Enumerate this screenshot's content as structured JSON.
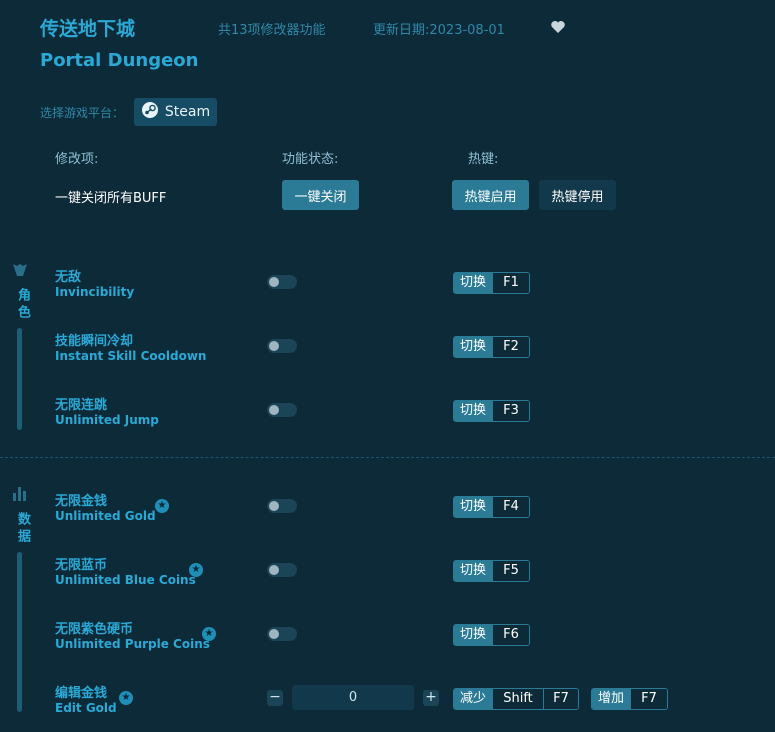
{
  "header": {
    "title_cn": "传送地下城",
    "title_en": "Portal Dungeon",
    "count": "共13项修改器功能",
    "updated": "更新日期:2023-08-01",
    "favorite_icon": "heart-icon"
  },
  "platform": {
    "label": "选择游戏平台：",
    "steam": "Steam"
  },
  "columns": {
    "mod": "修改项:",
    "status": "功能状态:",
    "hotkey": "热键:"
  },
  "global": {
    "label": "一键关闭所有BUFF",
    "close_all": "一键关闭",
    "hotkey_on": "热键启用",
    "hotkey_off": "热键停用"
  },
  "categories": [
    {
      "label": "角色",
      "icon": "character-icon"
    },
    {
      "label": "数据",
      "icon": "data-icon"
    }
  ],
  "options": [
    {
      "cn": "无敌",
      "en": "Invincibility",
      "action": "切换",
      "key": "F1",
      "enabled": false
    },
    {
      "cn": "技能瞬间冷却",
      "en": "Instant Skill Cooldown",
      "action": "切换",
      "key": "F2",
      "enabled": false
    },
    {
      "cn": "无限连跳",
      "en": "Unlimited Jump",
      "action": "切换",
      "key": "F3",
      "enabled": false
    },
    {
      "cn": "无限金钱",
      "en": "Unlimited Gold",
      "action": "切换",
      "key": "F4",
      "enabled": false,
      "starred": true
    },
    {
      "cn": "无限蓝币",
      "en": "Unlimited Blue Coins",
      "action": "切换",
      "key": "F5",
      "enabled": false,
      "starred": true
    },
    {
      "cn": "无限紫色硬币",
      "en": "Unlimited Purple Coins",
      "action": "切换",
      "key": "F6",
      "enabled": false,
      "starred": true
    }
  ],
  "edit_gold": {
    "cn": "编辑金钱",
    "en": "Edit Gold",
    "value": "0",
    "minus": "−",
    "plus": "+",
    "decrease": "减少",
    "increase": "增加",
    "mod_key": "Shift",
    "key": "F7",
    "inc_key": "F7"
  },
  "colors": {
    "background": "#0d2a38",
    "accent": "#2aa9d6",
    "button": "#2b7b97"
  }
}
